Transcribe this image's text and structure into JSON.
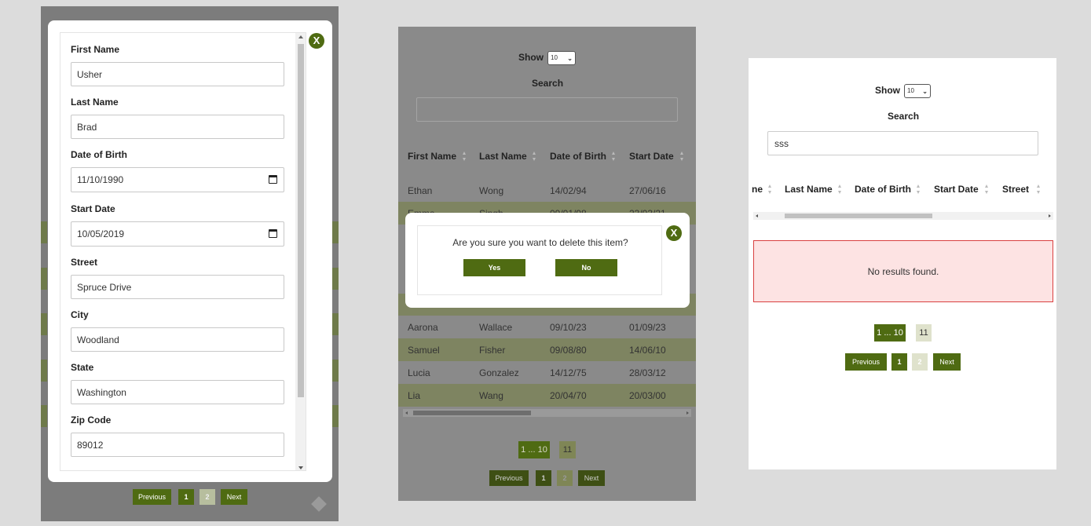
{
  "edit_modal": {
    "close_label": "X",
    "fields": [
      {
        "label": "First Name",
        "value": "Usher",
        "type": "text"
      },
      {
        "label": "Last Name",
        "value": "Brad",
        "type": "text"
      },
      {
        "label": "Date of Birth",
        "value": "11/10/1990",
        "type": "date"
      },
      {
        "label": "Start Date",
        "value": "10/05/2019",
        "type": "date"
      },
      {
        "label": "Street",
        "value": "Spruce Drive",
        "type": "text"
      },
      {
        "label": "City",
        "value": "Woodland",
        "type": "text"
      },
      {
        "label": "State",
        "value": "Washington",
        "type": "text"
      },
      {
        "label": "Zip Code",
        "value": "89012",
        "type": "text"
      }
    ],
    "pagination": {
      "previous": "Previous",
      "page1": "1",
      "page2": "2",
      "next": "Next"
    }
  },
  "delete_view": {
    "show_label": "Show",
    "show_value": "10",
    "search_label": "Search",
    "search_value": "",
    "columns": [
      "First Name",
      "Last Name",
      "Date of Birth",
      "Start Date"
    ],
    "rows": [
      [
        "Ethan",
        "Wong",
        "14/02/94",
        "27/06/16"
      ],
      [
        "Emma",
        "Singh",
        "09/01/98",
        "23/03/21"
      ],
      [
        "Aarona",
        "Wallace",
        "09/10/23",
        "01/09/23"
      ],
      [
        "Samuel",
        "Fisher",
        "09/08/80",
        "14/06/10"
      ],
      [
        "Lucia",
        "Gonzalez",
        "14/12/75",
        "28/03/12"
      ],
      [
        "Lia",
        "Wang",
        "20/04/70",
        "20/03/00"
      ]
    ],
    "dialog": {
      "message": "Are you sure you want to delete this item?",
      "yes": "Yes",
      "no": "No",
      "close_label": "X"
    },
    "page_range": {
      "current": "1 ... 10",
      "next": "11"
    },
    "pagination": {
      "previous": "Previous",
      "page1": "1",
      "page2": "2",
      "next": "Next"
    }
  },
  "search_view": {
    "show_label": "Show",
    "show_value": "10",
    "search_label": "Search",
    "search_value": "sss",
    "columns": [
      "ne",
      "Last Name",
      "Date of Birth",
      "Start Date",
      "Street"
    ],
    "no_results": "No results found.",
    "page_range": {
      "current": "1 ... 10",
      "next": "11"
    },
    "pagination": {
      "previous": "Previous",
      "page1": "1",
      "page2": "2",
      "next": "Next"
    }
  },
  "colors": {
    "accent": "#4f6b12",
    "accent_light": "#b7be9e",
    "error_bg": "#fde3e3",
    "error_border": "#d94040"
  }
}
